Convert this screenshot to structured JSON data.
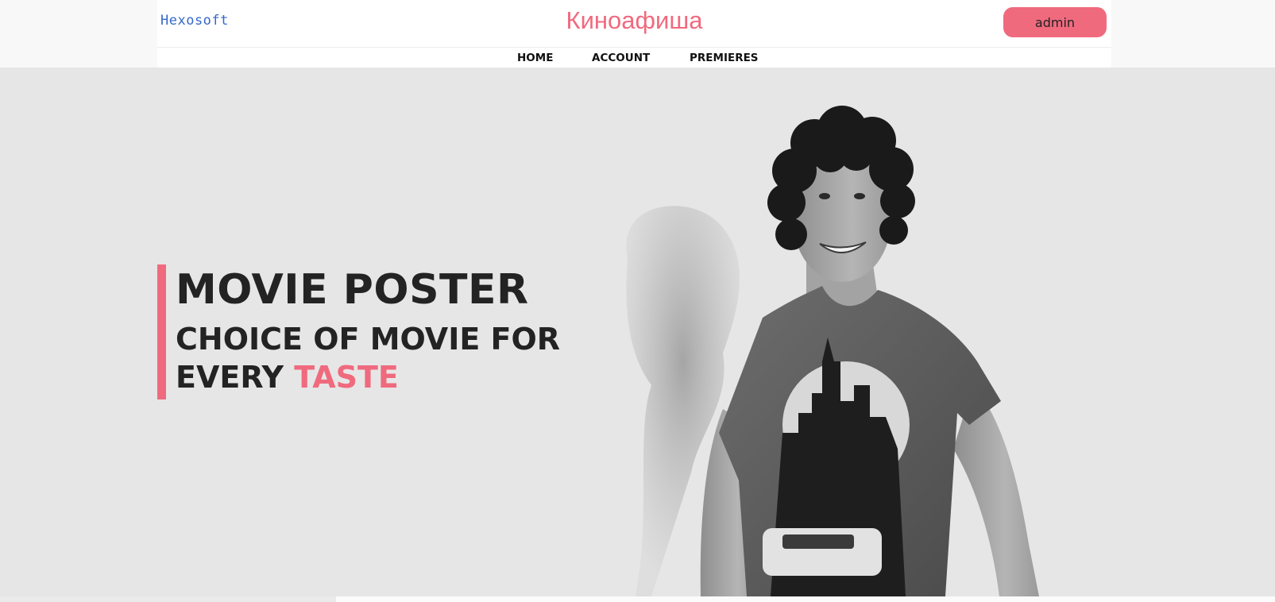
{
  "header": {
    "brand": "Hexosoft",
    "title": "Киноафиша",
    "user_button": "admin"
  },
  "nav": {
    "items": [
      "HOME",
      "ACCOUNT",
      "PREMIERES"
    ]
  },
  "hero": {
    "heading": "MOVIE POSTER",
    "subheading_line1": "CHOICE OF MOVIE FOR",
    "subheading_line2_prefix": "EVERY ",
    "subheading_highlight": "TASTE",
    "image_alt": "smiling-man-photo"
  },
  "colors": {
    "accent": "#f06a7e",
    "brand": "#3569c9",
    "hero_background": "#e6e6e6",
    "text_dark": "#232323"
  }
}
